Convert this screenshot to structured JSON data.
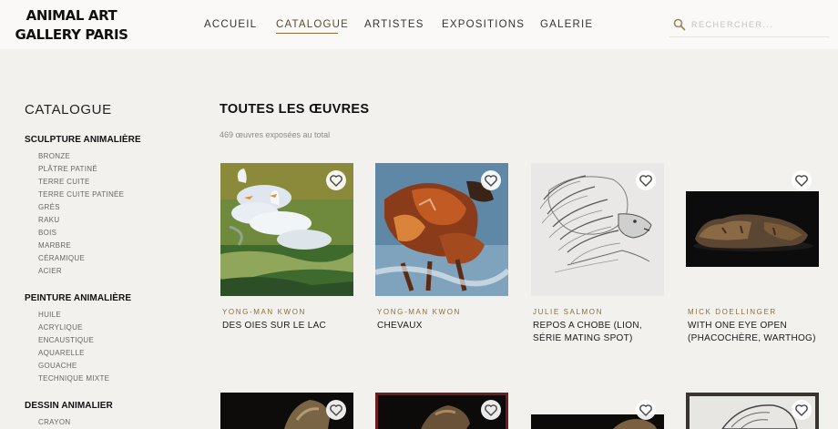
{
  "header": {
    "logo_line1": "ANIMAL ART",
    "logo_line2": "GALLERY PARIS",
    "nav": [
      {
        "label": "ACCUEIL"
      },
      {
        "label": "CATALOGUE"
      },
      {
        "label": "ARTISTES"
      },
      {
        "label": "EXPOSITIONS"
      },
      {
        "label": "GALERIE"
      }
    ],
    "active_nav": "CATALOGUE",
    "search_placeholder": "RECHERCHER...",
    "search_icon": "search-icon"
  },
  "sidebar": {
    "title": "CATALOGUE",
    "categories": [
      {
        "label": "SCULPTURE ANIMALIÈRE",
        "items": [
          "BRONZE",
          "PLÂTRE PATINÉ",
          "TERRE CUITE",
          "TERRE CUITE PATINÉE",
          "GRÈS",
          "RAKU",
          "BOIS",
          "MARBRE",
          "CÉRAMIQUE",
          "ACIER"
        ]
      },
      {
        "label": "PEINTURE ANIMALIÈRE",
        "items": [
          "HUILE",
          "ACRYLIQUE",
          "ENCAUSTIQUE",
          "AQUARELLE",
          "GOUACHE",
          "TECHNIQUE MIXTE"
        ]
      },
      {
        "label": "DESSIN ANIMALIER",
        "items": [
          "CRAYON"
        ]
      }
    ]
  },
  "main": {
    "title": "TOUTES LES ŒUVRES",
    "count_text": "469 œuvres exposées au total",
    "artworks": [
      {
        "artist": "YONG-MAN KWON",
        "title": "DES OIES SUR LE LAC",
        "icon": "heart-icon"
      },
      {
        "artist": "YONG-MAN KWON",
        "title": "CHEVAUX",
        "icon": "heart-icon"
      },
      {
        "artist": "JULIE SALMON",
        "title": "REPOS A CHOBE (LION, SÉRIE MATING SPOT)",
        "icon": "heart-icon"
      },
      {
        "artist": "MICK DOELLINGER",
        "title": "WITH ONE EYE OPEN (PHACOCHÈRE, WARTHOG)",
        "icon": "heart-icon"
      }
    ]
  },
  "colors": {
    "background": "#f3f1ee",
    "header": "#faf9f7",
    "accent": "#8a6f3a"
  }
}
